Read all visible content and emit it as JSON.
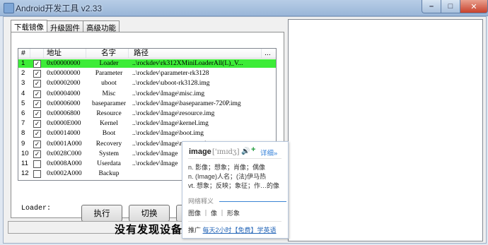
{
  "window": {
    "title": "Android开发工具 v2.33",
    "min_label": "–",
    "max_label": "□",
    "close_label": "✕"
  },
  "tabs": [
    {
      "label": "下载镜像",
      "active": true
    },
    {
      "label": "升级固件",
      "active": false
    },
    {
      "label": "高级功能",
      "active": false
    }
  ],
  "table": {
    "headers": {
      "num": "#",
      "addr": "地址",
      "name": "名字",
      "path": "路径",
      "more": "..."
    },
    "rows": [
      {
        "num": "1",
        "checked": "✓",
        "addr": "0x00000000",
        "name": "Loader",
        "path": "..\\rockdev\\rk312XMiniLoaderAll(L)_V...",
        "highlight": true
      },
      {
        "num": "2",
        "checked": "✓",
        "addr": "0x00000000",
        "name": "Parameter",
        "path": "..\\rockdev\\parameter-rk3128"
      },
      {
        "num": "3",
        "checked": "✓",
        "addr": "0x00002000",
        "name": "uboot",
        "path": "..\\rockdev\\uboot-rk3128.img"
      },
      {
        "num": "4",
        "checked": "✓",
        "addr": "0x00004000",
        "name": "Misc",
        "path": "..\\rockdev\\Image\\misc.img"
      },
      {
        "num": "5",
        "checked": "✓",
        "addr": "0x00006000",
        "name": "baseparamer",
        "path": "..\\rockdev\\Image\\baseparamer-720P.img"
      },
      {
        "num": "6",
        "checked": "✓",
        "addr": "0x00006800",
        "name": "Resource",
        "path": "..\\rockdev\\Image\\resource.img"
      },
      {
        "num": "7",
        "checked": "✓",
        "addr": "0x0000E000",
        "name": "Kernel",
        "path": "..\\rockdev\\Image\\kernel.img"
      },
      {
        "num": "8",
        "checked": "✓",
        "addr": "0x00014000",
        "name": "Boot",
        "path": "..\\rockdev\\Image\\boot.img"
      },
      {
        "num": "9",
        "checked": "✓",
        "addr": "0x0001A000",
        "name": "Recovery",
        "path": "..\\rockdev\\Image\\recovery.img"
      },
      {
        "num": "10",
        "checked": "✓",
        "addr": "0x0028C000",
        "name": "System",
        "path": "..\\rockdev\\Image"
      },
      {
        "num": "11",
        "checked": "",
        "addr": "0x0008A000",
        "name": "Userdata",
        "path": "..\\rockdev\\Image"
      },
      {
        "num": "12",
        "checked": "",
        "addr": "0x0002A000",
        "name": "Backup",
        "path": ""
      }
    ]
  },
  "loader_label": "Loader:",
  "buttons": {
    "execute": "执行",
    "switch": "切换"
  },
  "status": "没有发现设备",
  "popup": {
    "word": "image",
    "phonetic": "['ɪmɪdʒ]",
    "speak_icon": "🔊",
    "add_icon": "+",
    "detail": "详细»",
    "defs": [
      "n. 影像；想象；肖像；偶像",
      "n. (Image)人名；(法)伊马热",
      "vt. 想象；反映；象征；作…的像"
    ],
    "net_title": "网络释义",
    "net_items": "图像 ｜ 像 ｜ 形象",
    "ad_prefix": "推广",
    "ad_link": "每天2小时【免费】学英语"
  }
}
